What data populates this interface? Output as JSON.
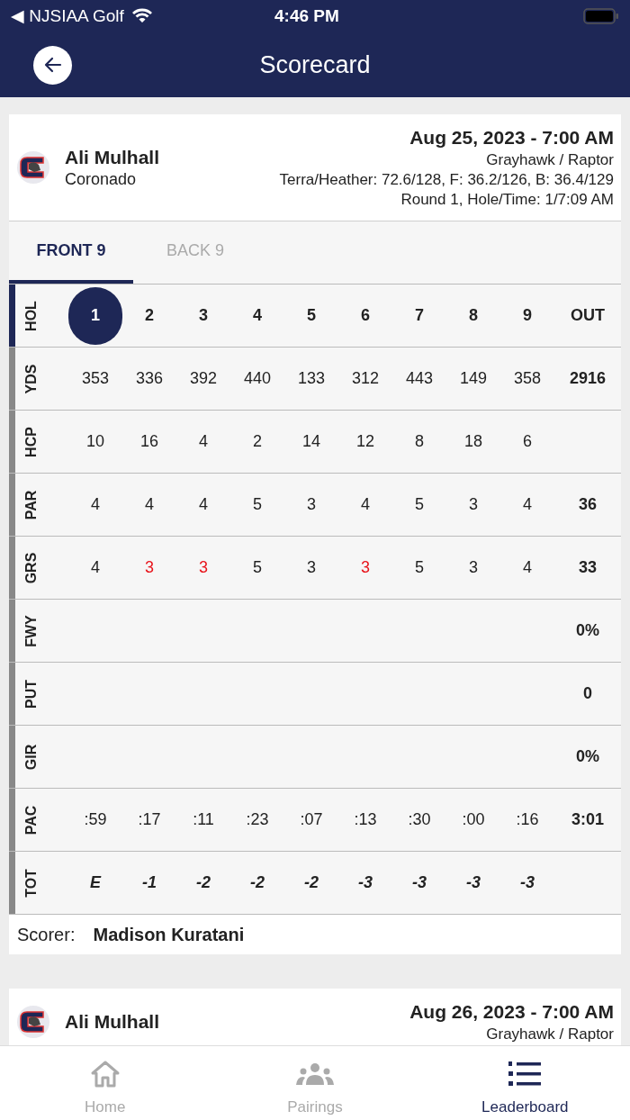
{
  "status_bar": {
    "back_app": "◀ NJSIAA Golf",
    "time": "4:46 PM"
  },
  "header": {
    "title": "Scorecard"
  },
  "cards": [
    {
      "player": "Ali Mulhall",
      "school": "Coronado",
      "date": "Aug 25, 2023 - 7:00 AM",
      "course": "Grayhawk / Raptor",
      "tees": "Terra/Heather: 72.6/128, F: 36.2/126, B: 36.4/129",
      "round": "Round 1, Hole/Time: 1/7:09 AM",
      "tabs": [
        {
          "label": "FRONT 9",
          "selected": true
        },
        {
          "label": "BACK 9",
          "selected": false
        }
      ],
      "rows": [
        {
          "label": "HOL",
          "kind": "hole",
          "cells": [
            {
              "text": "1",
              "selected": true
            },
            {
              "text": "2",
              "selected": false
            },
            {
              "text": "3",
              "selected": false
            },
            {
              "text": "4",
              "selected": false
            },
            {
              "text": "5",
              "selected": false
            },
            {
              "text": "6",
              "selected": false
            },
            {
              "text": "7",
              "selected": false
            },
            {
              "text": "8",
              "selected": false
            },
            {
              "text": "9",
              "selected": false
            }
          ],
          "total": "OUT"
        },
        {
          "label": "YDS",
          "kind": "plain",
          "cells": [
            "353",
            "336",
            "392",
            "440",
            "133",
            "312",
            "443",
            "149",
            "358"
          ],
          "total": "2916"
        },
        {
          "label": "HCP",
          "kind": "plain",
          "cells": [
            "10",
            "16",
            "4",
            "2",
            "14",
            "12",
            "8",
            "18",
            "6"
          ]
        },
        {
          "label": "PAR",
          "kind": "plain",
          "cells": [
            "4",
            "4",
            "4",
            "5",
            "3",
            "4",
            "5",
            "3",
            "4"
          ],
          "total": "36"
        },
        {
          "label": "GRS",
          "kind": "score",
          "cells": [
            {
              "text": "4",
              "under_par": false
            },
            {
              "text": "3",
              "under_par": true
            },
            {
              "text": "3",
              "under_par": true
            },
            {
              "text": "5",
              "under_par": false
            },
            {
              "text": "3",
              "under_par": false
            },
            {
              "text": "3",
              "under_par": true
            },
            {
              "text": "5",
              "under_par": false
            },
            {
              "text": "3",
              "under_par": false
            },
            {
              "text": "4",
              "under_par": false
            }
          ],
          "total": "33"
        },
        {
          "label": "FWY",
          "kind": "plain",
          "total": "0%"
        },
        {
          "label": "PUT",
          "kind": "plain",
          "total": "0"
        },
        {
          "label": "GIR",
          "kind": "plain",
          "total": "0%"
        },
        {
          "label": "PAC",
          "kind": "plain",
          "cells": [
            ":59",
            ":17",
            ":11",
            ":23",
            ":07",
            ":13",
            ":30",
            ":00",
            ":16"
          ],
          "total": "3:01"
        },
        {
          "label": "TOT",
          "kind": "running",
          "cells": [
            "E",
            "-1",
            "-2",
            "-2",
            "-2",
            "-3",
            "-3",
            "-3",
            "-3"
          ]
        }
      ],
      "scorer_label": "Scorer:",
      "scorer": "Madison Kuratani"
    },
    {
      "player": "Ali Mulhall",
      "date": "Aug 26, 2023 - 7:00 AM",
      "course": "Grayhawk / Raptor"
    }
  ],
  "tab_bar": [
    {
      "label": "Home",
      "selected": false
    },
    {
      "label": "Pairings",
      "selected": false
    },
    {
      "label": "Leaderboard",
      "selected": true
    }
  ]
}
